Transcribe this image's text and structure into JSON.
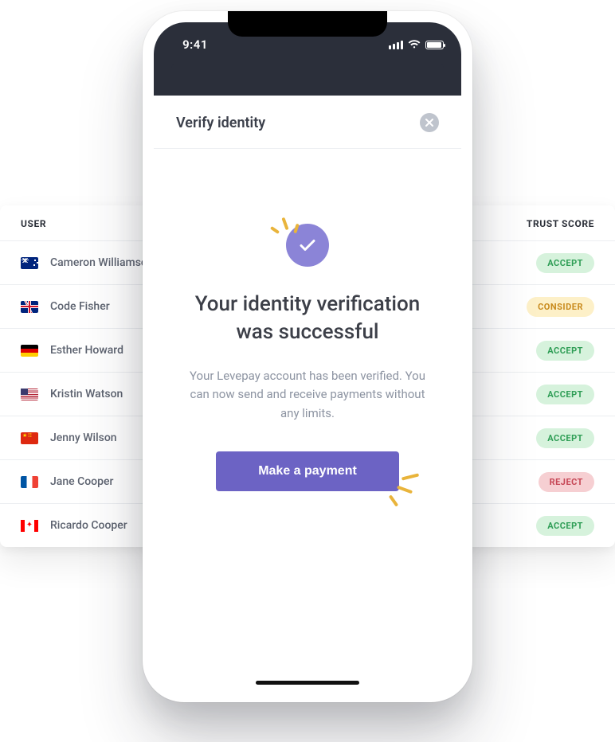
{
  "table": {
    "columns": {
      "user": "USER",
      "trust_score": "TRUST SCORE"
    },
    "rows": [
      {
        "flag": "au",
        "name": "Cameron Williamson",
        "status": "ACCEPT",
        "status_kind": "accept"
      },
      {
        "flag": "gb",
        "name": "Code Fisher",
        "status": "CONSIDER",
        "status_kind": "consider"
      },
      {
        "flag": "de",
        "name": "Esther Howard",
        "status": "ACCEPT",
        "status_kind": "accept"
      },
      {
        "flag": "us",
        "name": "Kristin Watson",
        "status": "ACCEPT",
        "status_kind": "accept"
      },
      {
        "flag": "cn",
        "name": "Jenny Wilson",
        "status": "ACCEPT",
        "status_kind": "accept"
      },
      {
        "flag": "fr",
        "name": "Jane Cooper",
        "status": "REJECT",
        "status_kind": "reject"
      },
      {
        "flag": "ca",
        "name": "Ricardo Cooper",
        "status": "ACCEPT",
        "status_kind": "accept"
      }
    ]
  },
  "phone": {
    "status_time": "9:41",
    "header_title": "Verify identity",
    "heading": "Your identity verification was successful",
    "subtext": "Your Levepay account has been verified. You can now send and receive payments without any limits.",
    "cta_label": "Make a payment"
  },
  "colors": {
    "accent": "#6c63c4",
    "badge_bg": "#8b84d7",
    "spark": "#e9b43b"
  }
}
